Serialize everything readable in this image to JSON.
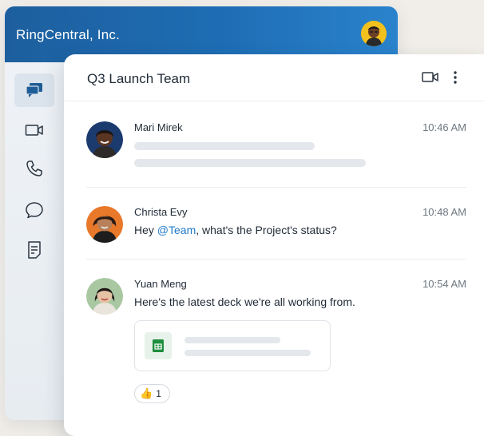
{
  "app": {
    "company_name": "RingCentral, Inc."
  },
  "rail": {
    "items": [
      {
        "icon": "chat-bubbles-icon",
        "active": true
      },
      {
        "icon": "video-icon",
        "active": false
      },
      {
        "icon": "phone-icon",
        "active": false
      },
      {
        "icon": "message-icon",
        "active": false
      },
      {
        "icon": "notes-icon",
        "active": false
      }
    ]
  },
  "conversation": {
    "title": "Q3 Launch Team",
    "actions": [
      "video-call-icon",
      "more-vertical-icon"
    ]
  },
  "messages": [
    {
      "author": "Mari Mirek",
      "time": "10:46 AM",
      "text": ""
    },
    {
      "author": "Christa Evy",
      "time": "10:48 AM",
      "text_before": "Hey ",
      "mention": "@Team",
      "text_after": ", what's the Project's status?"
    },
    {
      "author": "Yuan Meng",
      "time": "10:54 AM",
      "text": "Here's the latest deck we're all working from.",
      "attachment_icon": "spreadsheet-icon",
      "reaction": {
        "emoji": "👍",
        "count": "1"
      }
    }
  ],
  "colors": {
    "header_blue": "#1e6db4",
    "mention_blue": "#1f7ac9",
    "sheet_green": "#1e8e3e",
    "avatar_yellow": "#f3c11d",
    "avatar_navy": "#1b3b6f",
    "avatar_orange": "#e8782a",
    "avatar_sage": "#a9c8a2"
  }
}
